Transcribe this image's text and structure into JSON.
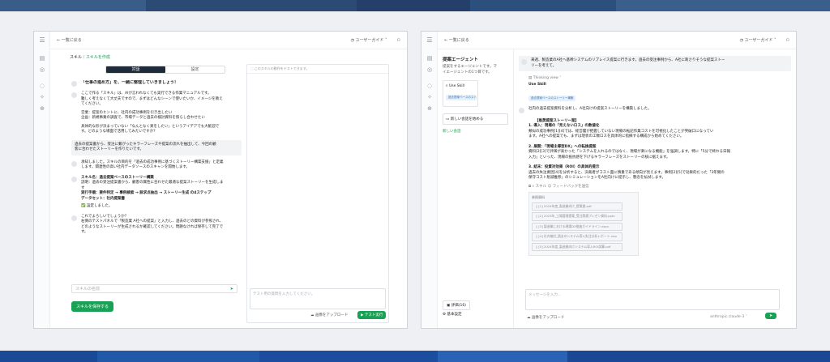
{
  "colors": {
    "accent": "#17a255",
    "frame_border": "#cfd3d8",
    "top_band": "#2f4f7a",
    "bottom_band": "#1f4f9a"
  },
  "left_window": {
    "back_label": "← 一覧に戻る",
    "guide_label": "ユーザーガイド ˅",
    "breadcrumb": {
      "root": "スキル",
      "sep": "/",
      "current": "スキルを作成"
    },
    "tabs": [
      "対話",
      "設定"
    ],
    "test_header": "このスキルの動作をテストできます。",
    "messages": [
      {
        "lines": [
          "「仕事の進め方」を、一緒に整理していきましょう！"
        ],
        "bold_first": true
      },
      {
        "lines": [
          "ここで作る「スキル」は、AIが言われなくても実行できる作業マニュアルです。",
          "難しく考えなくて大丈夫ですので、まずはどんなシーンで使いたいか、イメージを教え",
          "てください。",
          "",
          "営業：提案のヒントに、社内の成功事例を引き出したい",
          "企画：新規事業の調査で、市場データと過去の検討資料を照らし合わせたい",
          "",
          "具体的な形が決まっていない「なんとなく楽をしたい」というアイデアでも大歓迎で",
          "す。どのような場面で活用してみたいですか？"
        ]
      },
      {
        "lines": [
          "過去の提案書から、受注に繋がったキラーフレーズや提案の流れを抽出して、今回の顧",
          "客に合わせたストーリーを作りたいです。"
        ],
        "user": true
      },
      {
        "lines": [
          "承知しました。スキルの目的を「過去の成功事例に基づくストーリー構築支援」と定義",
          "します。関連性の高い社内データソースのスキャンを開始します。"
        ]
      },
      {
        "lines": [
          "スキル名：過去提案ベースのストーリー構築",
          "説明：過去の受注提案書から、顧客の属性に合わせた最適な提案ストーリーを生成しま",
          "す",
          "実行手順：要件特定 → 事例検索 → 訴求点抽出 → ストーリー生成 の4ステップ",
          "データセット：社内提案書"
        ],
        "spec": true
      },
      {
        "lines": [
          "設定しました。"
        ],
        "check": true
      },
      {
        "lines": [
          "これでよろしいでしょうか？",
          "右側のテストパネルで「製造業 A社への提案」と入力し、過去のどの資料が参照され、",
          "どのようなストーリーが生成されるか確認してください。問題なければ保存して完了で",
          "す。"
        ]
      }
    ],
    "skill_name_placeholder": "スキルの名前",
    "save_button": "スキルを保存する",
    "test_input_placeholder": "テスト用の質問を入力してください。",
    "upload_label": "画像をアップロード",
    "run_button": "テスト実行"
  },
  "right_window": {
    "back_label": "← 一覧に戻る",
    "guide_label": "ユーザーガイド ˅",
    "agent_title": "提案エージェント",
    "agent_desc": [
      "提案をするエージェントです。マ",
      "イエージェントの1つ目です。"
    ],
    "agent_skill_label": "Use Skill",
    "agent_skill_tag": "過去提案ベースのストーリー構築",
    "new_chat": "新しい会話を始める",
    "new_chat_link": "新しい会話",
    "eval_label": "評価(16)",
    "settings_label": "基本設定",
    "user_message": [
      "来週、製造業のA社へ基幹システムのリプレイス提案に行きます。過去の受注事例から、A社に刺さりそうな提案ストー",
      "リーを考えて。"
    ],
    "thinking_label": "Thinking view ˅",
    "use_skill_label": "Use Skill",
    "use_skill_tag": "過去提案ベースのストーリー構築",
    "answer_intro": "社内の過去提案資料を分析し、A社向けの提案ストーリーを構築しました。",
    "answer_heading": "【推奨提案ストーリー案】",
    "sections": [
      {
        "title": "1. 導入：現場の「見えないロス」の数値化",
        "lines": [
          "類似の成功事例[1][4]では、経営層が把握していない現場の転記作業コストを可視化したことが突破口になってい",
          "ます。A社への提案でも、まずは現状の工数ロスを具体的に指摘する構成から始めてください。"
        ]
      },
      {
        "title": "2. 展開：「現場主導型DX」への転換提案",
        "lines": [
          "資料[2][3]で評価が高かった「システムを入れるのではなく、現場が楽になる機能」を強調します。特に「5分で終わる日報",
          "入力」といった、現場の抵抗感を下げるキラーフレーズをストーリーの核に据えます。"
        ]
      },
      {
        "title": "3. 結末：投資対効果（ROI）の具体的提示",
        "lines": [
          "過去の失注要因[4]を分析すると、決裁者がコスト面に慎重である傾向が見えます。事例[2][5]で効果的だった「3年間の",
          "保守コスト削減推移」のシミュレーションをA社向けに提示し、懸念を払拭します。"
        ]
      }
    ],
    "action_skill": "スキル",
    "action_feedback": "フィードバックを送信",
    "refs_title": "参照資料",
    "refs": [
      "[1] 2024年度_製造業向け_提案書.pdf",
      "[2] 2023年_工場管理提案_受注実績プレゼン資料.pptx",
      "[3] 製造業における現場DX推進ガイドライン.docx",
      "[4] 社内検討_過去のシステム導入失注分析レポート.xlsx",
      "[5] 2024年度_製造業向けシステム導入ROI試算.pdf"
    ],
    "chat_placeholder": "メッセージを入力...",
    "upload_label": "画像をアップロード",
    "model_label": "anthropic.claude-3 ˅"
  }
}
